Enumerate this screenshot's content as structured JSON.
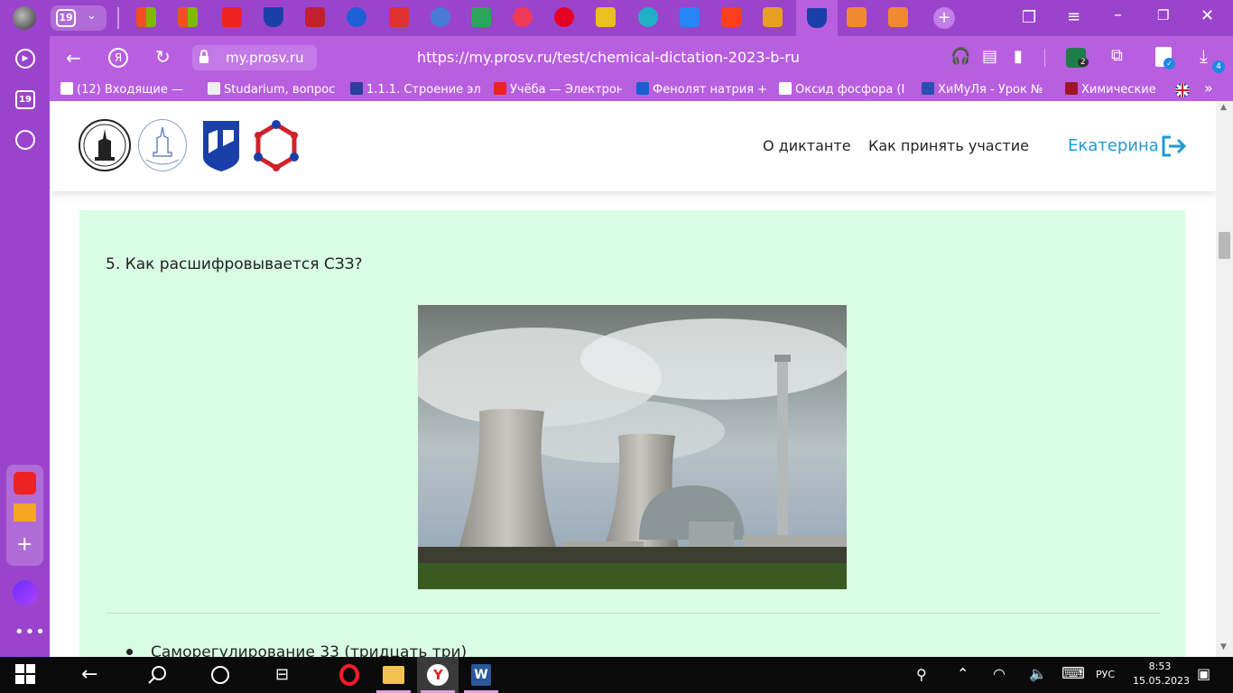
{
  "tabs": {
    "count_badge": "19"
  },
  "sidebar": {
    "count_badge": "19"
  },
  "address_bar": {
    "domain": "my.prosv.ru",
    "url": "https://my.prosv.ru/test/chemical-dictation-2023-b-ru",
    "downloads_badge": "4",
    "extension_badge": "2"
  },
  "bookmarks": [
    "(12) Входящие — ",
    "Studarium, вопрос",
    "1.1.1. Строение эл",
    "Учёба — Электрон",
    "Фенолят натрия +",
    "Оксид фосфора (І",
    "ХиМуЛя - Урок №",
    "Химические"
  ],
  "site": {
    "nav": [
      "О диктанте",
      "Как принять участие"
    ],
    "user_name": "Екатерина"
  },
  "question": {
    "text": "5. Как расшифровывается СЗЗ?",
    "option_1": "Саморегулирование 33 (тридцать три)"
  },
  "taskbar": {
    "language": "РУС",
    "time": "8:53",
    "date": "15.05.2023"
  },
  "colors": {
    "chrome_purple": "#9a44cc",
    "address_purple": "#b85fe0",
    "panel_green": "#d9fde4",
    "accent_blue": "#1e9ad6"
  }
}
